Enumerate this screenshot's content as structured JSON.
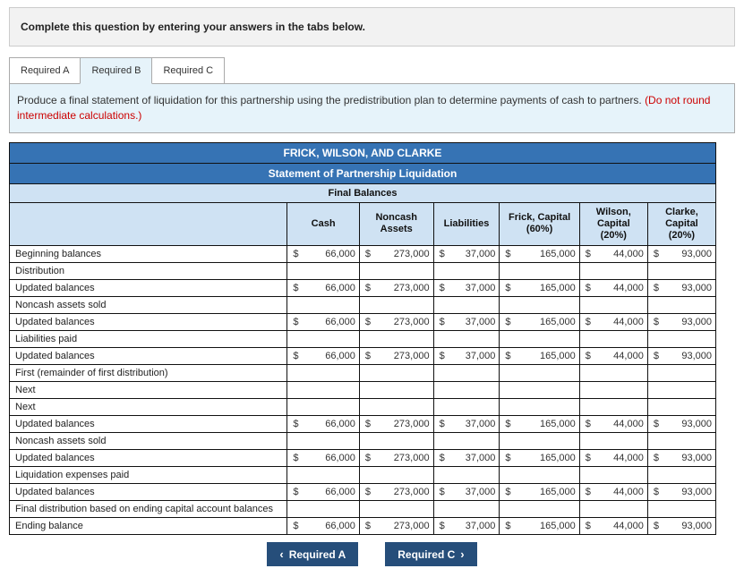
{
  "header": {
    "instruction_top": "Complete this question by entering your answers in the tabs below."
  },
  "tabs": {
    "a": "Required A",
    "b": "Required B",
    "c": "Required C"
  },
  "instruction": {
    "main": "Produce a final statement of liquidation for this partnership using the predistribution plan to determine payments of cash to partners. ",
    "warn": "(Do not round intermediate calculations.)"
  },
  "titles": {
    "company": "FRICK, WILSON, AND CLARKE",
    "stmt": "Statement of Partnership Liquidation",
    "final": "Final Balances"
  },
  "cols": {
    "cash": "Cash",
    "noncash": "Noncash Assets",
    "liab": "Liabilities",
    "frick": "Frick, Capital (60%)",
    "wilson": "Wilson, Capital (20%)",
    "clarke": "Clarke, Capital (20%)"
  },
  "rows": [
    {
      "label": "Beginning balances",
      "vals": {
        "cash": "66,000",
        "noncash": "273,000",
        "liab": "37,000",
        "frick": "165,000",
        "wilson": "44,000",
        "clarke": "93,000"
      }
    },
    {
      "label": "Distribution",
      "vals": null
    },
    {
      "label": "Updated balances",
      "vals": {
        "cash": "66,000",
        "noncash": "273,000",
        "liab": "37,000",
        "frick": "165,000",
        "wilson": "44,000",
        "clarke": "93,000"
      }
    },
    {
      "label": "Noncash assets sold",
      "vals": null
    },
    {
      "label": "Updated balances",
      "vals": {
        "cash": "66,000",
        "noncash": "273,000",
        "liab": "37,000",
        "frick": "165,000",
        "wilson": "44,000",
        "clarke": "93,000"
      }
    },
    {
      "label": "Liabilities paid",
      "vals": null
    },
    {
      "label": "Updated balances",
      "vals": {
        "cash": "66,000",
        "noncash": "273,000",
        "liab": "37,000",
        "frick": "165,000",
        "wilson": "44,000",
        "clarke": "93,000"
      }
    },
    {
      "label": "First (remainder of first distribution)",
      "vals": null
    },
    {
      "label": "Next",
      "vals": null
    },
    {
      "label": "Next",
      "vals": null
    },
    {
      "label": "Updated balances",
      "vals": {
        "cash": "66,000",
        "noncash": "273,000",
        "liab": "37,000",
        "frick": "165,000",
        "wilson": "44,000",
        "clarke": "93,000"
      }
    },
    {
      "label": "Noncash assets sold",
      "vals": null
    },
    {
      "label": "Updated balances",
      "vals": {
        "cash": "66,000",
        "noncash": "273,000",
        "liab": "37,000",
        "frick": "165,000",
        "wilson": "44,000",
        "clarke": "93,000"
      }
    },
    {
      "label": "Liquidation expenses paid",
      "vals": null
    },
    {
      "label": "Updated balances",
      "vals": {
        "cash": "66,000",
        "noncash": "273,000",
        "liab": "37,000",
        "frick": "165,000",
        "wilson": "44,000",
        "clarke": "93,000"
      }
    },
    {
      "label": "Final distribution based on ending capital account balances",
      "vals": null
    },
    {
      "label": "Ending balance",
      "vals": {
        "cash": "66,000",
        "noncash": "273,000",
        "liab": "37,000",
        "frick": "165,000",
        "wilson": "44,000",
        "clarke": "93,000"
      }
    }
  ],
  "nav": {
    "prev": "Required A",
    "next": "Required C"
  },
  "sym": "$"
}
